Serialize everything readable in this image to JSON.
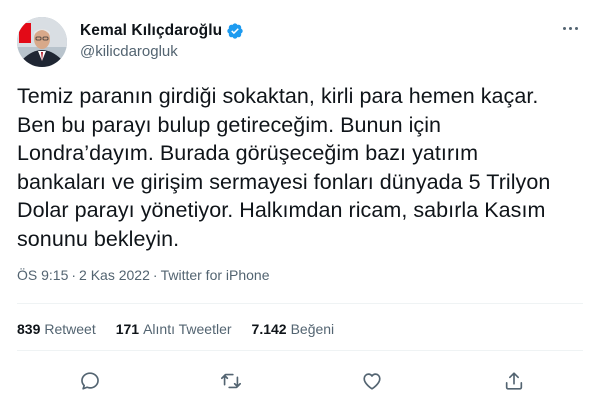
{
  "author": {
    "display_name": "Kemal Kılıçdaroğlu",
    "handle": "@kilicdarogluk",
    "verified": true,
    "avatar_icon": "profile-photo"
  },
  "tweet": {
    "text": "Temiz paranın girdiği sokaktan, kirli para hemen kaçar.\nBen bu parayı bulup getireceğim. Bunun için\nLondra’dayım. Burada görüşeceğim bazı yatırım\nbankaları ve girişim sermayesi fonları dünyada 5 Trilyon\nDolar parayı yönetiyor. Halkımdan ricam, sabırla Kasım\nsonunu bekleyin.",
    "time": "ÖS 9:15",
    "date": "2 Kas 2022",
    "source": "Twitter for iPhone",
    "separator": "·"
  },
  "stats": {
    "retweets_count": "839",
    "retweets_label": "Retweet",
    "quotes_count": "171",
    "quotes_label": "Alıntı Tweetler",
    "likes_count": "7.142",
    "likes_label": "Beğeni"
  },
  "actions": {
    "icons": [
      "reply-icon",
      "retweet-icon",
      "like-icon",
      "share-icon"
    ]
  },
  "colors": {
    "text": "#0f1419",
    "secondary": "#536471",
    "verified": "#1d9bf0",
    "divider": "#eff3f4"
  }
}
